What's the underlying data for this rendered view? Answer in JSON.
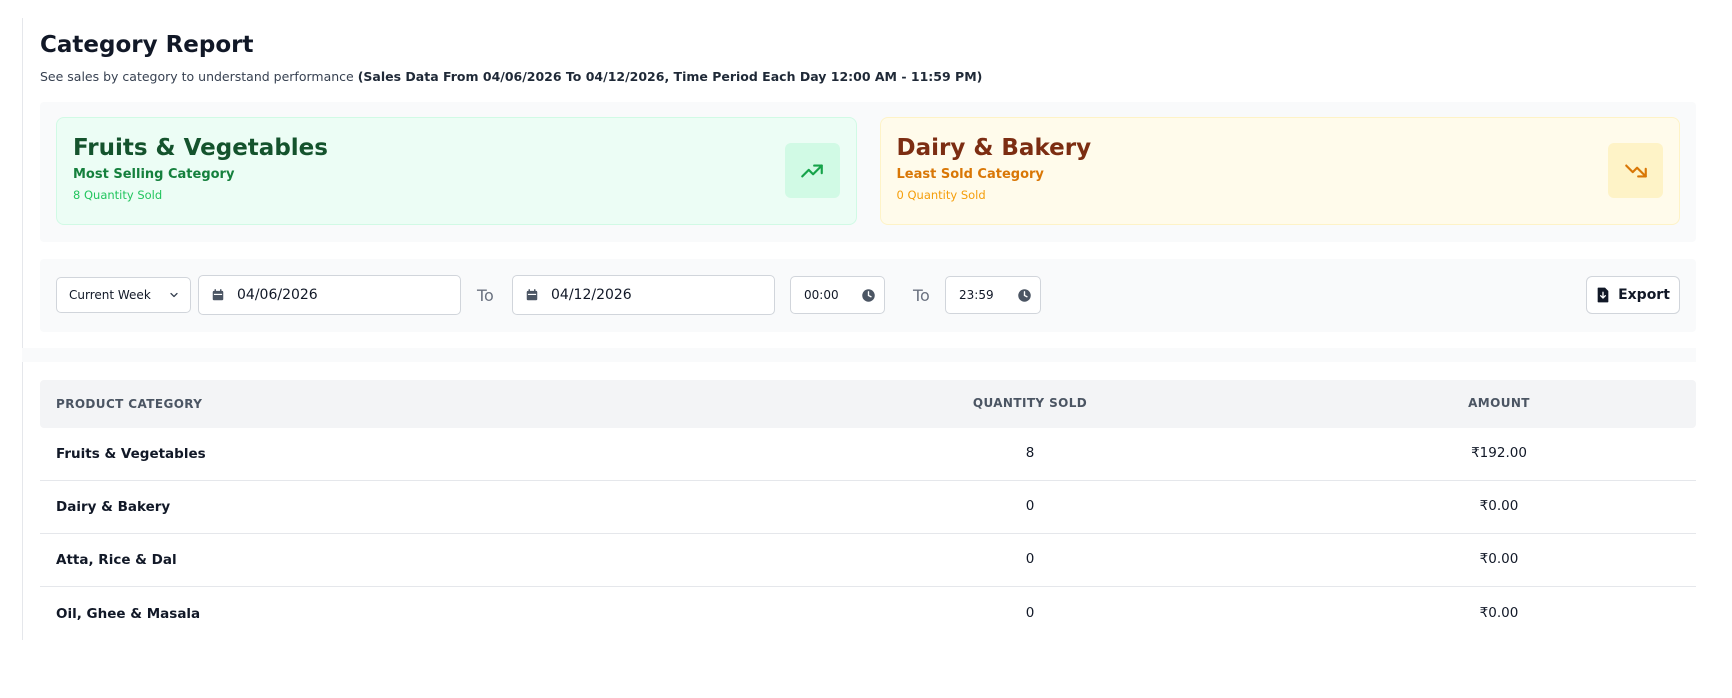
{
  "header": {
    "title": "Category Report",
    "subtitle": "See sales by category to understand performance",
    "range": "(Sales Data From 04/06/2026 To 04/12/2026, Time Period Each Day 12:00 AM - 11:59 PM)"
  },
  "cards": {
    "most": {
      "name": "Fruits & Vegetables",
      "kind": "Most Selling Category",
      "qty": "8 Quantity Sold",
      "icon": "trending-up-icon",
      "accent": "#22c55e"
    },
    "least": {
      "name": "Dairy & Bakery",
      "kind": "Least Sold Category",
      "qty": "0 Quantity Sold",
      "icon": "trending-down-icon",
      "accent": "#f59e0b"
    }
  },
  "filters": {
    "period": "Current Week",
    "from_date": "04/06/2026",
    "to_label": "To",
    "to_date": "04/12/2026",
    "from_time": "00:00",
    "to_time": "23:59",
    "export_label": "Export"
  },
  "table": {
    "headers": {
      "category": "PRODUCT CATEGORY",
      "quantity": "QUANTITY SOLD",
      "amount": "AMOUNT"
    },
    "rows": [
      {
        "category": "Fruits & Vegetables",
        "quantity": "8",
        "amount": "₹192.00"
      },
      {
        "category": "Dairy & Bakery",
        "quantity": "0",
        "amount": "₹0.00"
      },
      {
        "category": "Atta, Rice & Dal",
        "quantity": "0",
        "amount": "₹0.00"
      },
      {
        "category": "Oil, Ghee & Masala",
        "quantity": "0",
        "amount": "₹0.00"
      }
    ]
  }
}
